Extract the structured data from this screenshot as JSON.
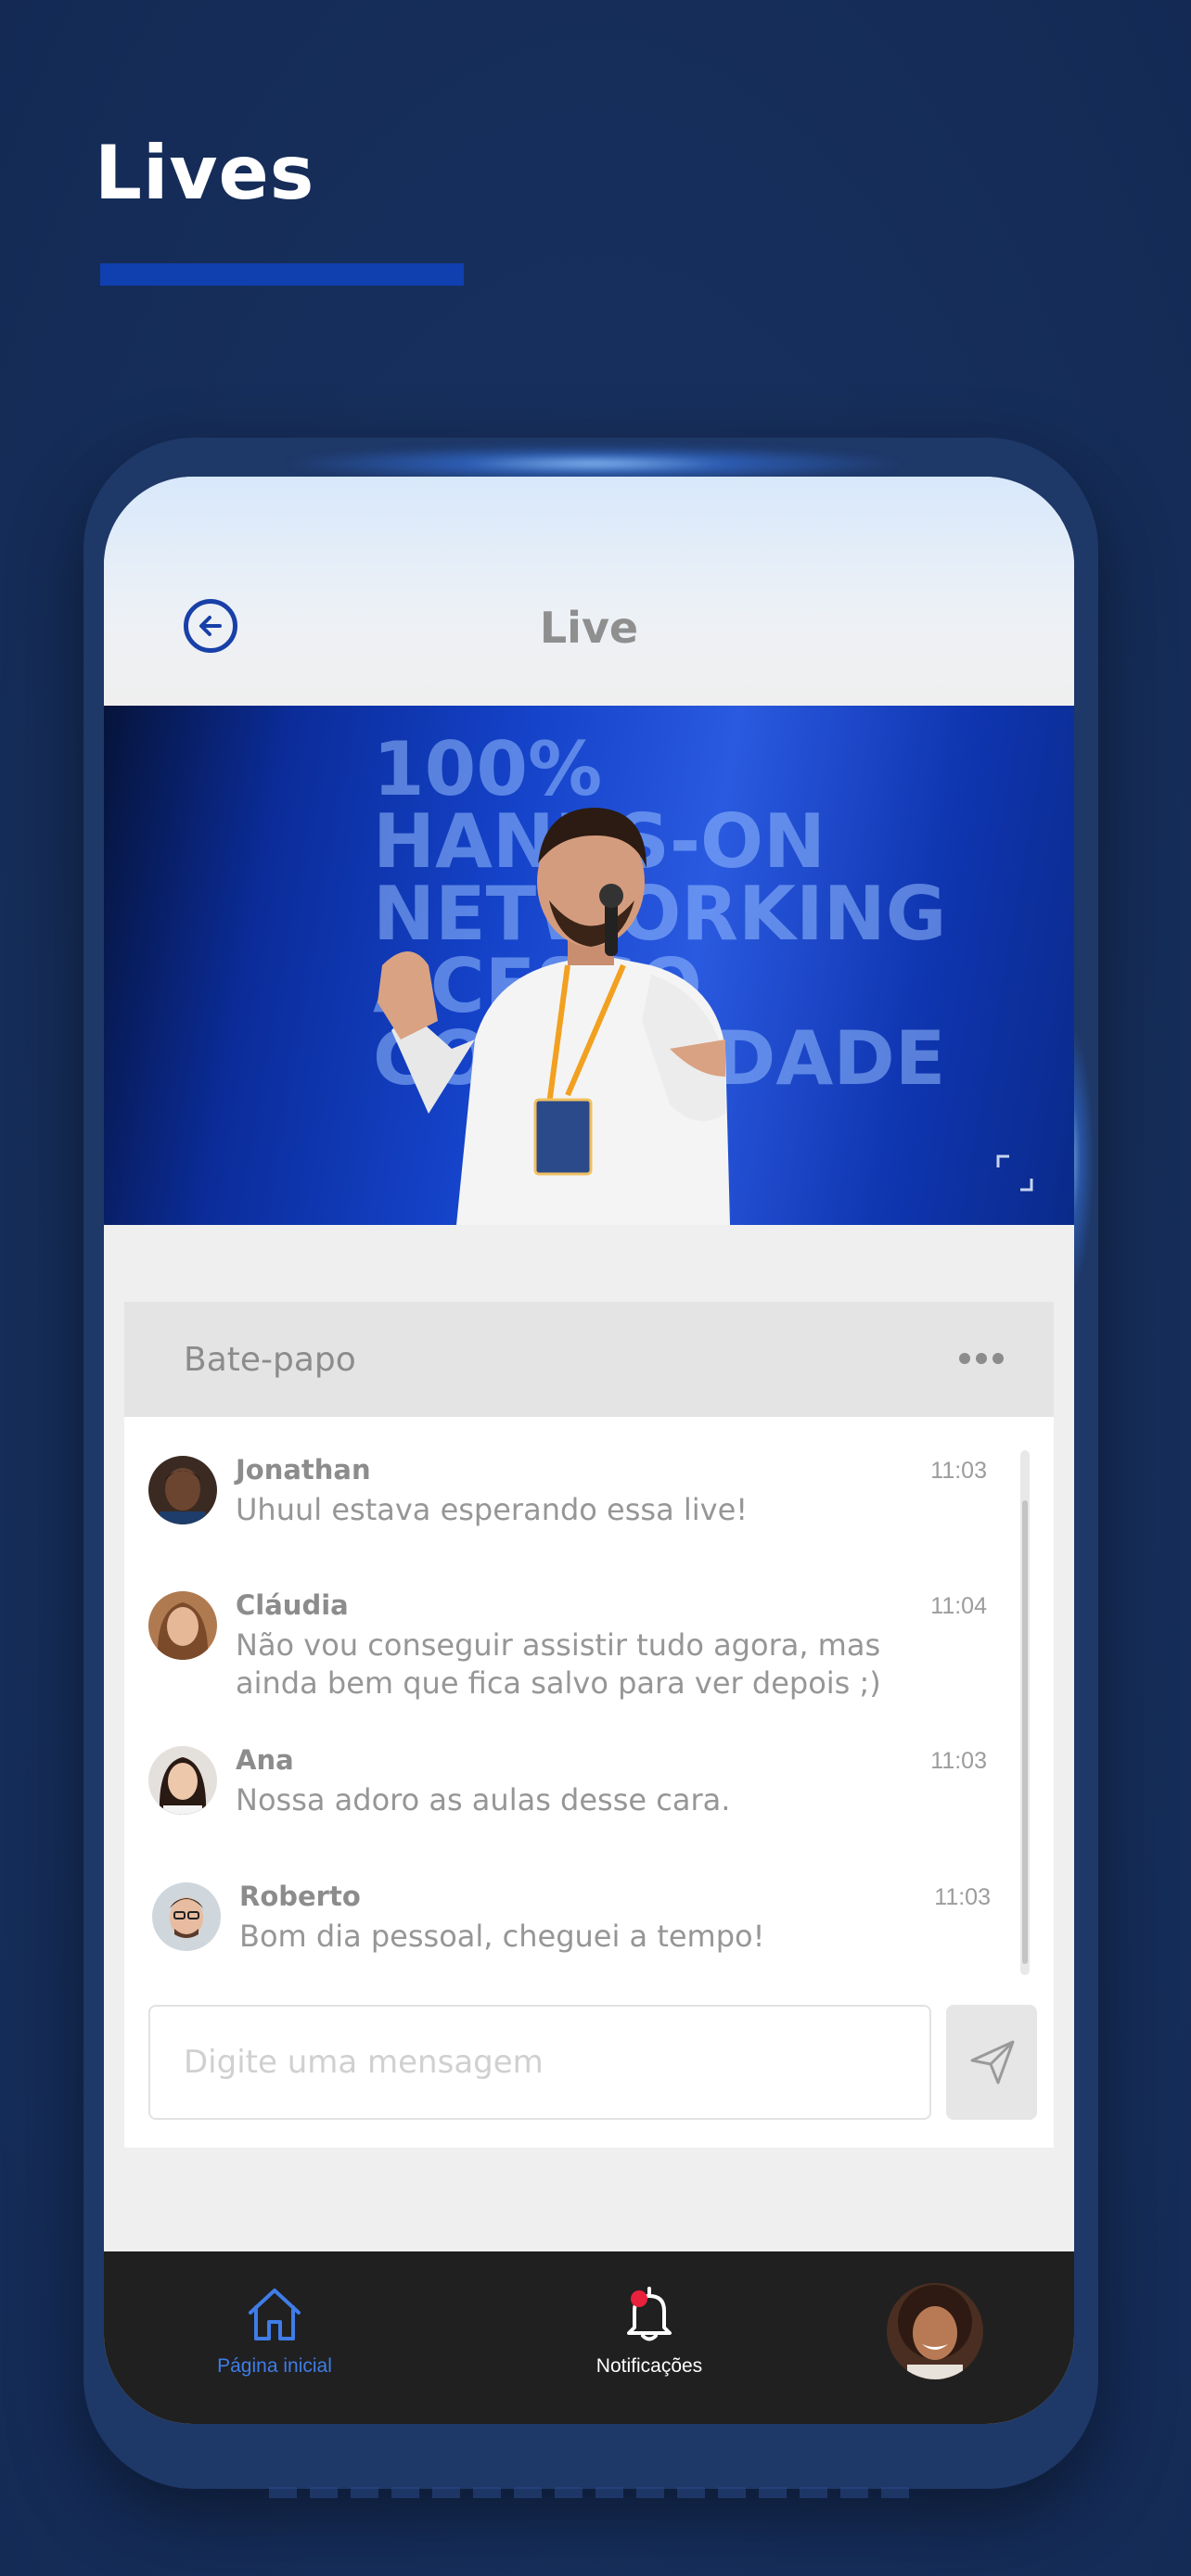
{
  "promo": {
    "title": "Lives"
  },
  "header": {
    "title": "Live",
    "back_icon": "arrow-left-circle-icon"
  },
  "video": {
    "stage_lines": [
      "100%",
      "HANDS-ON",
      "NETWORKING",
      "ACESSO",
      "COMUNIDADE"
    ],
    "fullscreen_icon": "fullscreen-icon"
  },
  "chat": {
    "title": "Bate-papo",
    "more_icon": "more-horizontal-icon",
    "messages": [
      {
        "name": "Jonathan",
        "time": "11:03",
        "text": "Uhuul estava esperando essa live!"
      },
      {
        "name": "Cláudia",
        "time": "11:04",
        "text": "Não vou conseguir assistir tudo agora, mas ainda bem que fica salvo para ver depois ;)"
      },
      {
        "name": "Ana",
        "time": "11:03",
        "text": "Nossa adoro as aulas desse cara."
      },
      {
        "name": "Roberto",
        "time": "11:03",
        "text": "Bom dia pessoal, cheguei a tempo!"
      }
    ],
    "input_placeholder": "Digite uma mensagem",
    "send_icon": "send-icon"
  },
  "bottom_nav": {
    "home_label": "Página inicial",
    "notifications_label": "Notificações",
    "active": "home"
  },
  "colors": {
    "accent": "#1840a8",
    "nav_active": "#3f7de8",
    "notification_dot": "#e8213c",
    "background": "#17305e"
  }
}
